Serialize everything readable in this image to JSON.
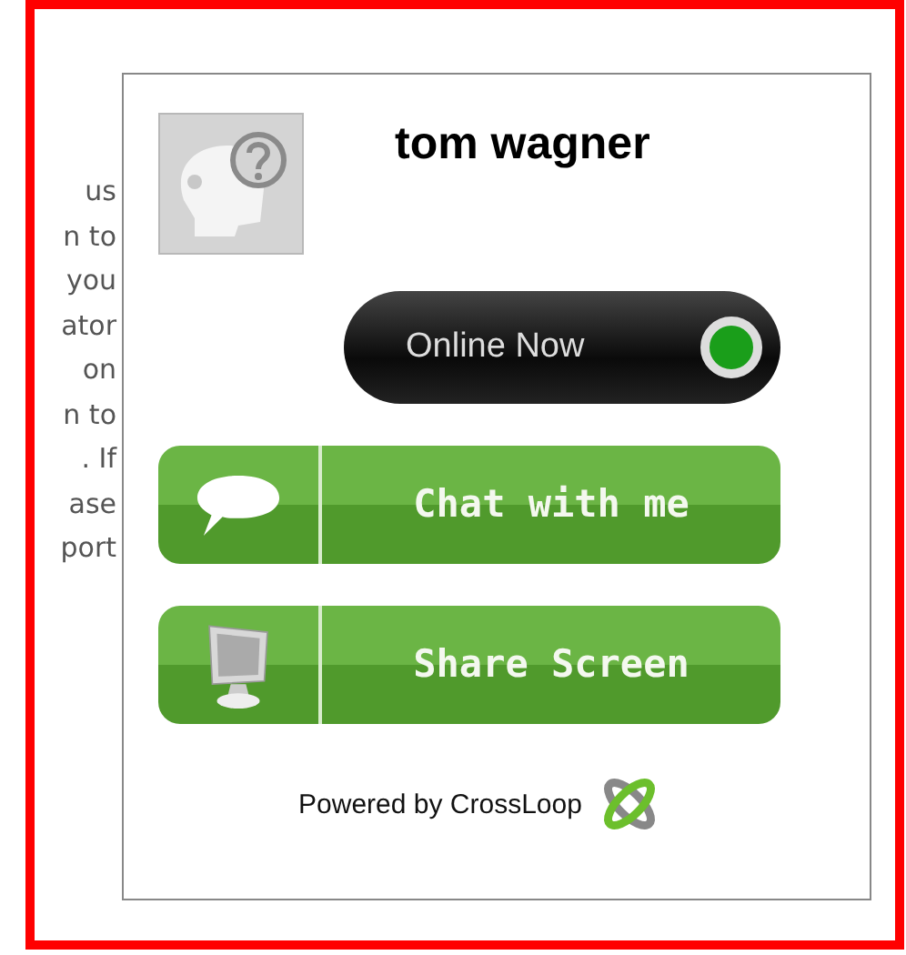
{
  "side_text": [
    "us",
    "n to",
    "you",
    "ator",
    "on",
    "n to",
    ". If",
    "ase",
    "port"
  ],
  "profile": {
    "name": "tom wagner",
    "status": {
      "label": "Online Now",
      "online": true
    }
  },
  "actions": [
    {
      "kind": "chat",
      "label": "Chat with me"
    },
    {
      "kind": "screen",
      "label": "Share Screen"
    }
  ],
  "footer": {
    "text": "Powered by CrossLoop"
  }
}
